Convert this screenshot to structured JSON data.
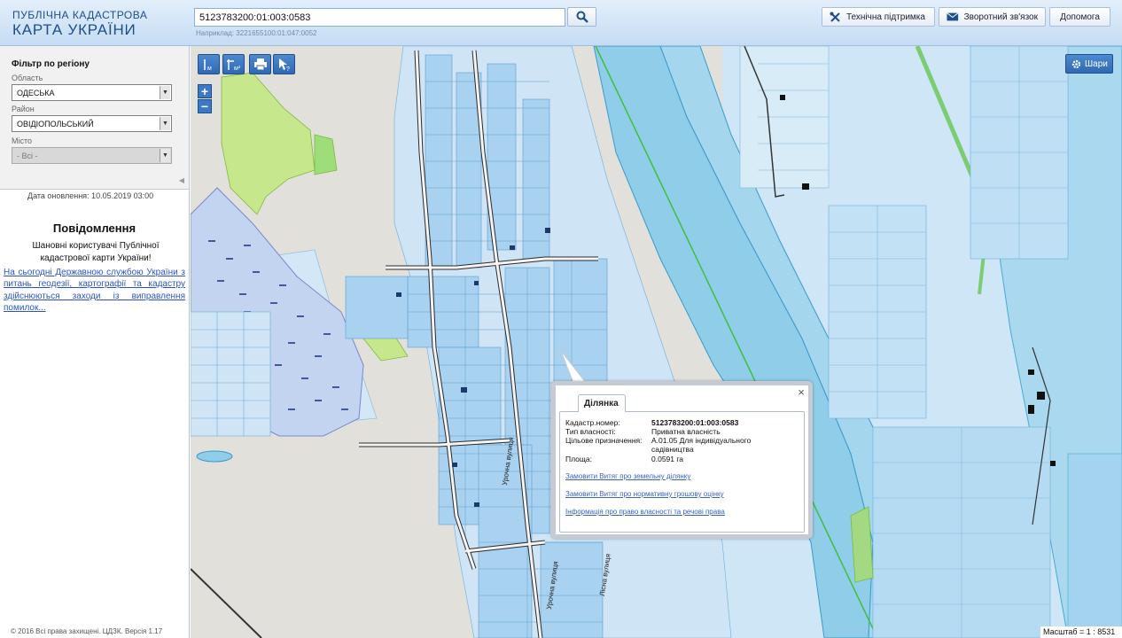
{
  "header": {
    "logo_top": "ПУБЛІЧНА КАДАСТРОВА",
    "logo_bottom": "КАРТА УКРАЇНИ",
    "search_value": "5123783200:01:003:0583",
    "search_hint": "Наприклад: 3221655100:01:047:0052",
    "buttons": {
      "support": "Технічна підтримка",
      "feedback": "Зворотний зв'язок",
      "help": "Допомога"
    }
  },
  "sidebar": {
    "filter_title": "Фільтр по регіону",
    "oblast_label": "Область",
    "oblast_value": "ОДЕСЬКА",
    "rayon_label": "Район",
    "rayon_value": "ОВІДІОПОЛЬСЬКИЙ",
    "misto_label": "Місто",
    "misto_value": "- Всі -",
    "update_date": "Дата оновлення: 10.05.2019 03:00",
    "notice_title": "Повідомлення",
    "notice_text": "Шановні користувачі Публічної кадастрової карти України!",
    "notice_link": "На сьогодні Державною службою України з питань геодезії, картографії та кадастру здійснюються заходи із виправлення помилок...",
    "copyright": "© 2016 Всі права захищені. ЦДЗК. Версія 1.17"
  },
  "map": {
    "layers_label": "Шари",
    "scale_label": "Масштаб = 1 : 8531",
    "street_labels": [
      "Урочна вулиця",
      "Урочна вулиця",
      "Лісна вулиця"
    ]
  },
  "popup": {
    "tab_label": "Ділянка",
    "rows": [
      {
        "label": "Кадастр.номер:",
        "value": "5123783200:01:003:0583"
      },
      {
        "label": "Тип власності:",
        "value": "Приватна власність"
      },
      {
        "label": "Цільове призначення:",
        "value": "А.01.05 Для індивідуального садівництва"
      },
      {
        "label": "Площа:",
        "value": "0.0591 га"
      }
    ],
    "links": [
      "Замовити Витяг про земельну ділянку",
      "Замовити Витяг про нормативну грошову оцінку",
      "Інформація про право власності та речові права"
    ]
  },
  "colors": {
    "header_bg": "#d6e6f7",
    "tool_blue": "#3b78c5",
    "water": "#9fd0ea",
    "parcel": "#b6d8f2",
    "green_area": "#c4e68a"
  }
}
